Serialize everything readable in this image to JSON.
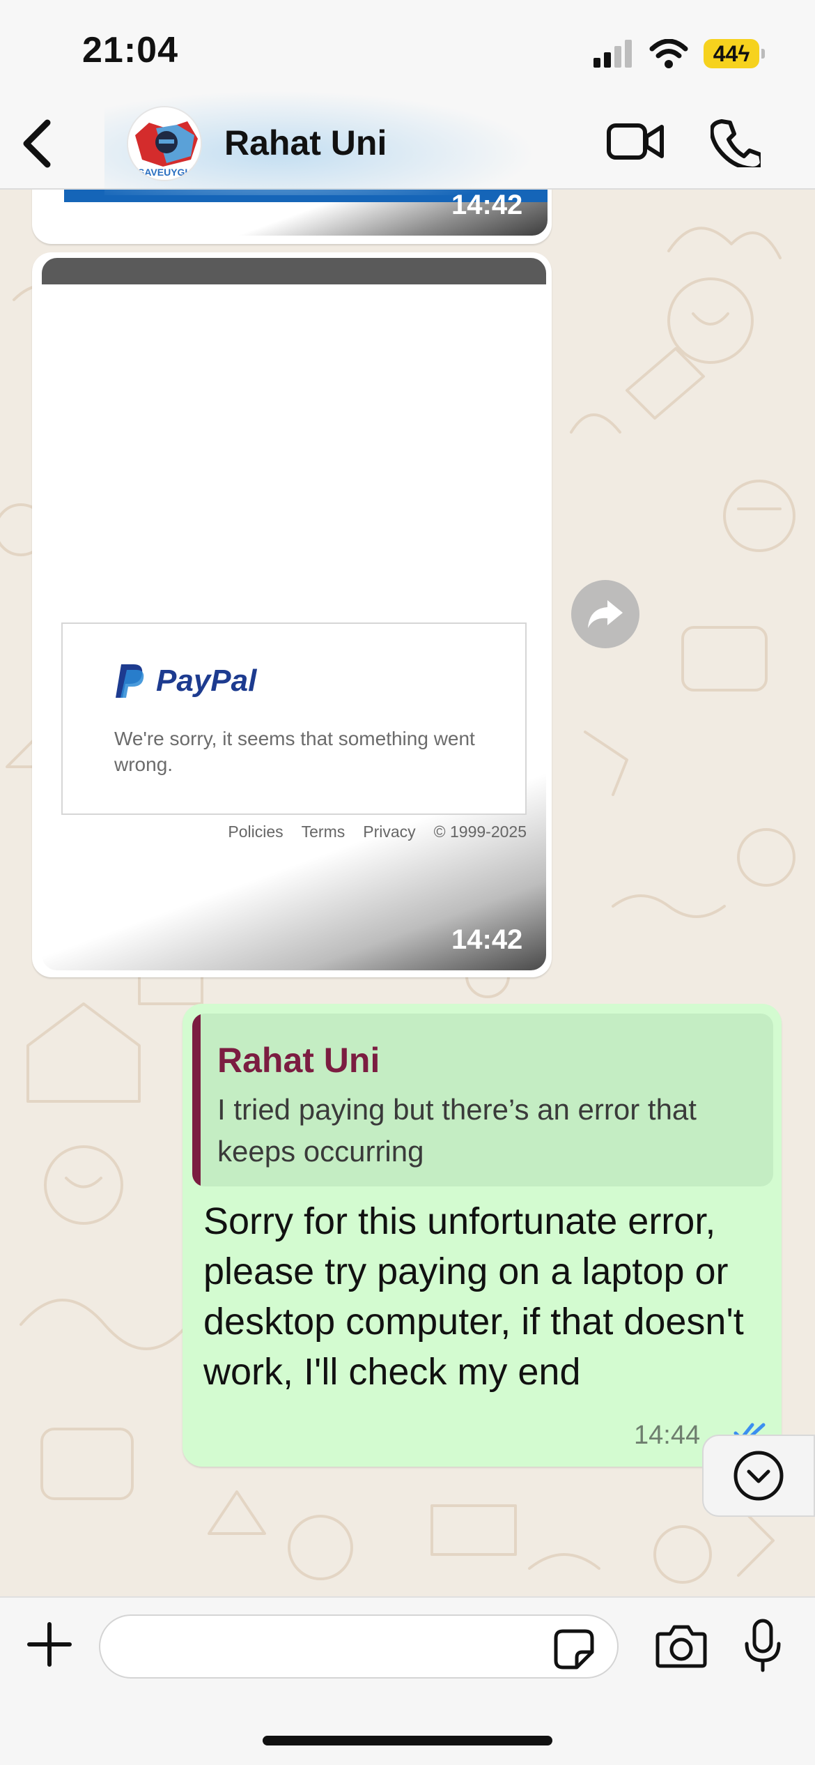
{
  "status_bar": {
    "time": "21:04",
    "battery": "44",
    "icons": [
      "signal-icon",
      "wifi-icon",
      "battery-charging-icon"
    ]
  },
  "header": {
    "contact_name": "Rahat Uni",
    "avatar_text": "SAVEUYGH",
    "icons": [
      "back-chevron-icon",
      "video-call-icon",
      "phone-call-icon"
    ]
  },
  "messages": {
    "incoming_top_time": "14:42",
    "incoming_screenshot": {
      "time": "14:42",
      "paypal_logo_text": "PayPal",
      "error_text": "We're sorry, it seems that something went wrong.",
      "footer_links": [
        "Policies",
        "Terms",
        "Privacy",
        "© 1999-2025"
      ]
    },
    "outgoing": {
      "quote_author": "Rahat Uni",
      "quote_text": "I tried paying but there’s an error that keeps occurring",
      "text": "Sorry for this unfortunate error, please try paying on a laptop or desktop computer, if that doesn't work, I'll check my end",
      "time": "14:44",
      "status": "read"
    }
  },
  "composer": {
    "placeholder": "",
    "icons": [
      "plus-icon",
      "sticker-icon",
      "camera-icon",
      "microphone-icon"
    ]
  },
  "colors": {
    "outgoing_bubble": "#d3fbd0",
    "quote_accent": "#7b1d41",
    "read_ticks": "#3b8ef0",
    "paypal_dark": "#1d3b8f",
    "paypal_light": "#2a8ad6"
  }
}
